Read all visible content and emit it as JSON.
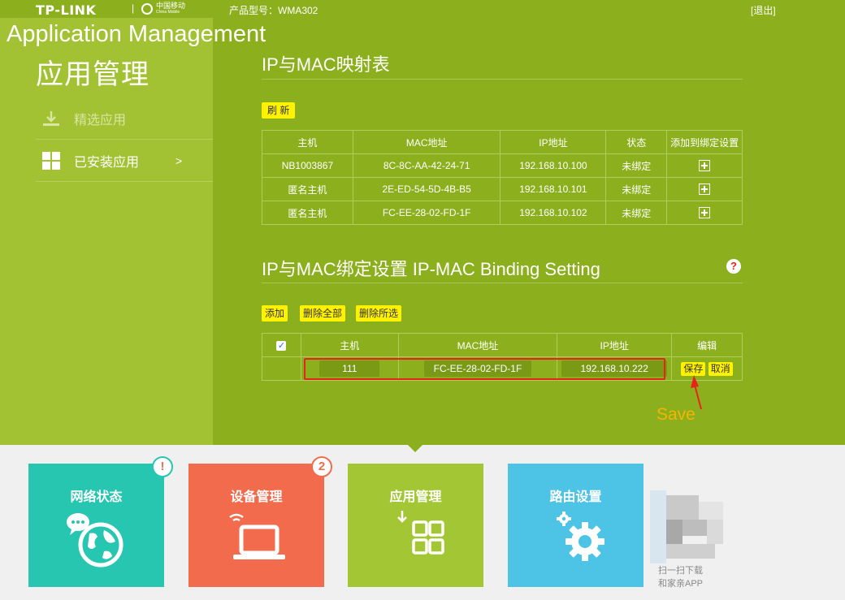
{
  "header": {
    "brand": "TP-LINK",
    "sep": "|",
    "partner_cn": "中国移动",
    "partner_en": "China Mobile",
    "model": "产品型号：WMA302",
    "logout": "[退出]"
  },
  "overlay_title": "Application Management",
  "sidebar": {
    "title": "应用管理",
    "items": [
      {
        "label": "精选应用",
        "icon": "download-icon"
      },
      {
        "label": "已安装应用",
        "icon": "apps-grid-icon",
        "chevron": ">"
      }
    ]
  },
  "mapping": {
    "title": "IP与MAC映射表",
    "refresh_label": "刷 新",
    "columns": [
      "主机",
      "MAC地址",
      "IP地址",
      "状态",
      "添加到绑定设置"
    ],
    "rows": [
      {
        "host": "NB1003867",
        "mac": "8C-8C-AA-42-24-71",
        "ip": "192.168.10.100",
        "status": "未绑定"
      },
      {
        "host": "匿名主机",
        "mac": "2E-ED-54-5D-4B-B5",
        "ip": "192.168.10.101",
        "status": "未绑定"
      },
      {
        "host": "匿名主机",
        "mac": "FC-EE-28-02-FD-1F",
        "ip": "192.168.10.102",
        "status": "未绑定"
      }
    ]
  },
  "binding": {
    "title": "IP与MAC绑定设置  IP-MAC Binding Setting",
    "help": "?",
    "buttons": {
      "add": "添加",
      "delete_all": "删除全部",
      "delete_selected": "删除所选"
    },
    "columns": [
      "主机",
      "MAC地址",
      "IP地址",
      "编辑"
    ],
    "checkbox": "✓",
    "edit_row": {
      "host": "111",
      "mac": "FC-EE-28-02-FD-1F",
      "ip": "192.168.10.222",
      "save": "保存",
      "cancel": "取消"
    },
    "annotation": "Save"
  },
  "tiles": [
    {
      "label": "网络状态",
      "color": "#26c6b0",
      "badge": "!"
    },
    {
      "label": "设备管理",
      "color": "#f26b4c",
      "badge": "2"
    },
    {
      "label": "应用管理",
      "color": "#a3c634"
    },
    {
      "label": "路由设置",
      "color": "#4dc3e6"
    }
  ],
  "qr": {
    "line1": "扫一扫下载",
    "line2": "和家亲APP"
  }
}
